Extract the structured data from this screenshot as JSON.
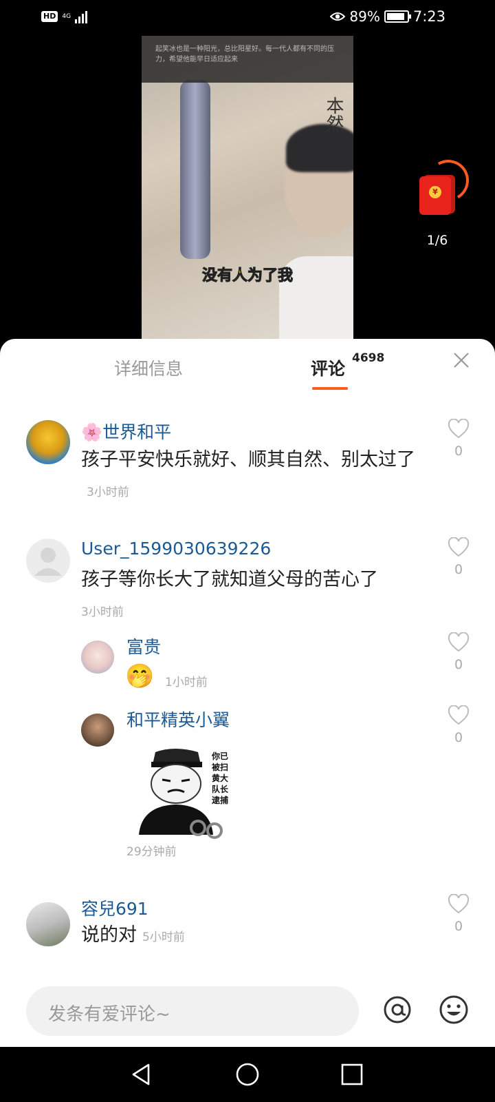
{
  "status_bar": {
    "hd": "HD",
    "network": "4G",
    "battery_percent": "89%",
    "battery_level": 0.89,
    "time": "7:23"
  },
  "video": {
    "caption_strip": "起笑冰也是一种阳光，总比阳星好。每一代人都有不同的压力，希望他能早日适应起来",
    "logo_text": "本然",
    "subtitle": "没有人为了我"
  },
  "red_packet": {
    "coin_symbol": "¥",
    "count": "1/6"
  },
  "tabs": {
    "details": "详细信息",
    "comments": "评论",
    "comments_count": "4698"
  },
  "comments": [
    {
      "username": "🌸世界和平",
      "text": "孩子平安快乐就好、顺其自然、别太过了",
      "time": "3小时前",
      "likes": "0",
      "avatar": "ginkgo-tree"
    },
    {
      "username": "User_1599030639226",
      "text": "孩子等你长大了就知道父母的苦心了",
      "time": "3小时前",
      "likes": "0",
      "avatar": "default-person"
    }
  ],
  "replies": [
    {
      "username": "富贵",
      "emoji": "🤭",
      "time": "1小时前",
      "likes": "0",
      "avatar": "anime-boy"
    },
    {
      "username": "和平精英小翼",
      "meme_text": [
        "你已",
        "被扫",
        "黄大",
        "队长",
        "逮捕"
      ],
      "time": "29分钟前",
      "likes": "0",
      "avatar": "footballer"
    }
  ],
  "comment3": {
    "username": "容兒691",
    "text": "说的对",
    "time": "5小时前",
    "likes": "0",
    "avatar": "building-sign"
  },
  "input": {
    "placeholder": "发条有爱评论~"
  },
  "colors": {
    "accent": "#ff5a1f",
    "username": "#1b5a96",
    "red_packet": "#e8231c"
  }
}
